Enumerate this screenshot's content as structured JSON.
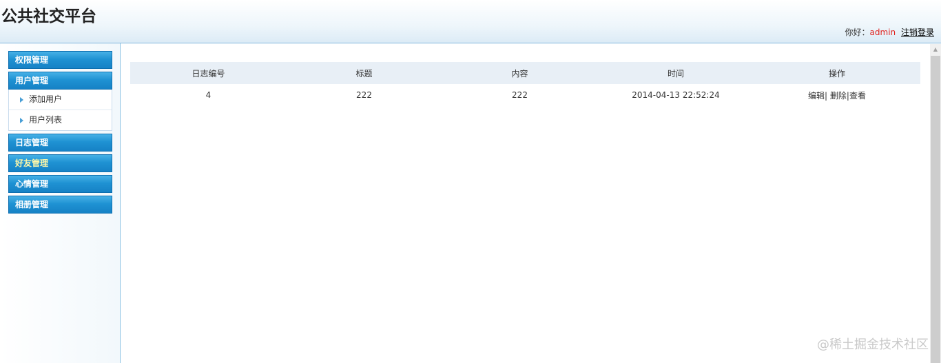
{
  "header": {
    "title": "公共社交平台",
    "greeting": "你好：",
    "username": "admin",
    "logout": "注销登录"
  },
  "sidebar": {
    "menu": [
      {
        "label": "权限管理"
      },
      {
        "label": "用户管理",
        "children": [
          {
            "label": "添加用户"
          },
          {
            "label": "用户列表"
          }
        ]
      },
      {
        "label": "日志管理"
      },
      {
        "label": "好友管理"
      },
      {
        "label": "心情管理"
      },
      {
        "label": "相册管理"
      }
    ]
  },
  "table": {
    "columns": [
      "日志编号",
      "标题",
      "内容",
      "时间",
      "操作"
    ],
    "rows": [
      {
        "id": "4",
        "title": "222",
        "content": "222",
        "time": "2014-04-13 22:52:24",
        "actions": {
          "edit": "编辑",
          "delete": "删除",
          "view": "查看",
          "sep": "|"
        }
      }
    ]
  },
  "watermark": "@稀土掘金技术社区"
}
